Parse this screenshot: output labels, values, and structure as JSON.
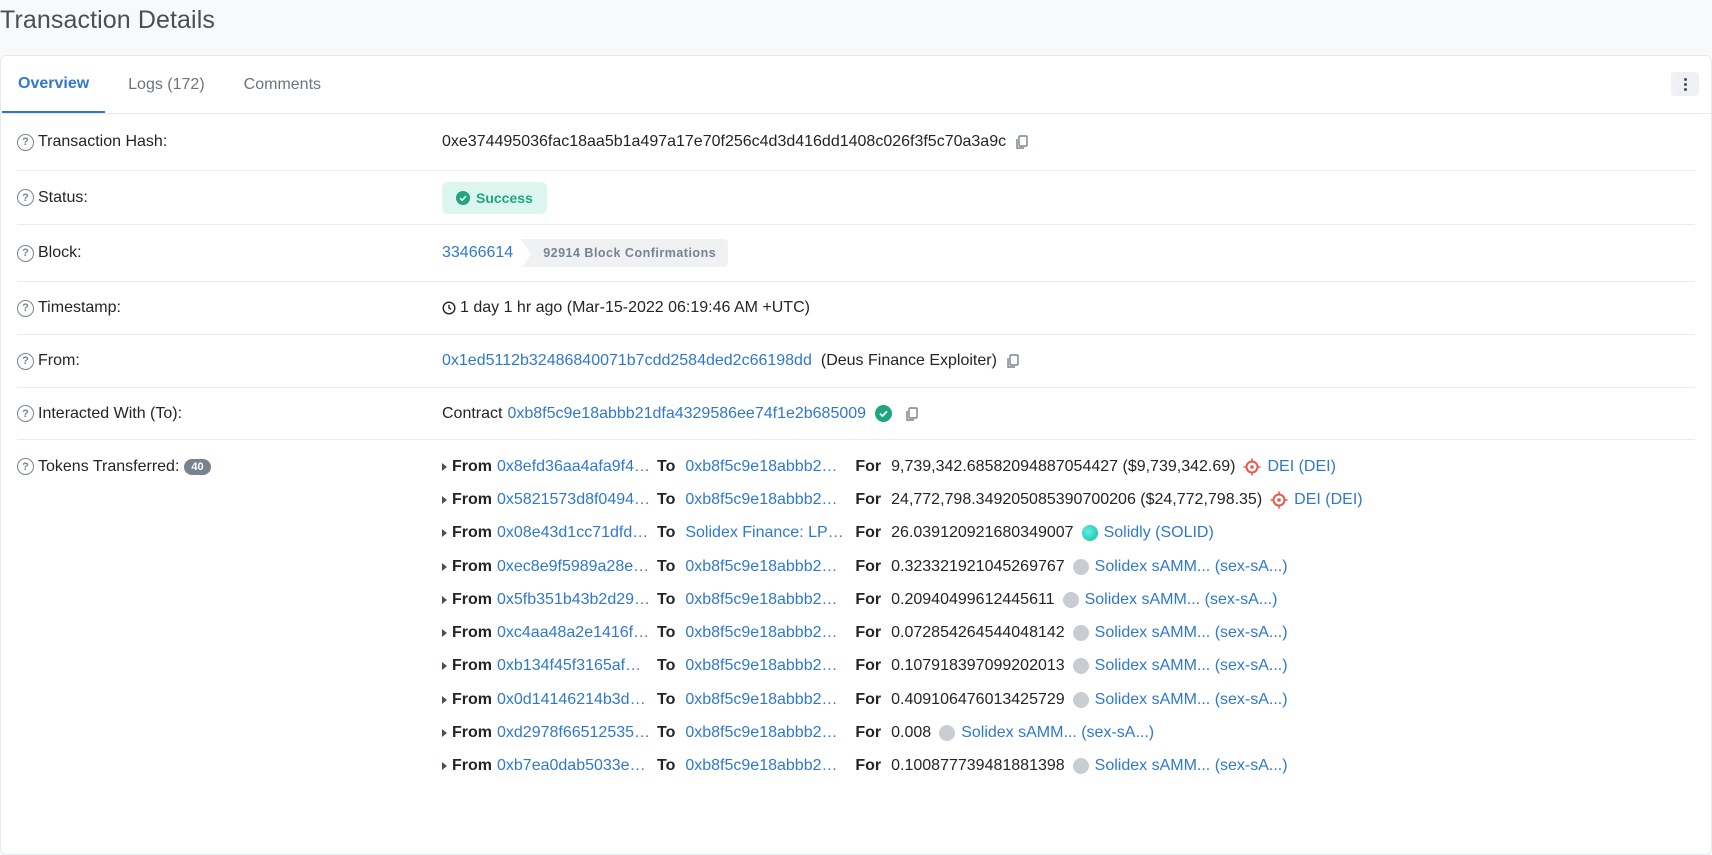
{
  "page": {
    "title": "Transaction Details"
  },
  "tabs": [
    {
      "label": "Overview"
    },
    {
      "label": "Logs (172)"
    },
    {
      "label": "Comments"
    }
  ],
  "overview": {
    "hash_label": "Transaction Hash:",
    "hash": "0xe374495036fac18aa5b1a497a17e70f256c4d3d416dd1408c026f3f5c70a3a9c",
    "status_label": "Status:",
    "status": "Success",
    "block_label": "Block:",
    "block": "33466614",
    "confirmations": "92914 Block Confirmations",
    "timestamp_label": "Timestamp:",
    "timestamp": "1 day 1 hr ago (Mar-15-2022 06:19:46 AM +UTC)",
    "from_label": "From:",
    "from": "0x1ed5112b32486840071b7cdd2584ded2c66198dd",
    "from_name": "(Deus Finance Exploiter)",
    "to_label": "Interacted With (To):",
    "to_prefix": "Contract",
    "to": "0xb8f5c9e18abbb21dfa4329586ee74f1e2b685009",
    "tokens_label": "Tokens Transferred:",
    "tokens_count": "40"
  },
  "transfers": {
    "from_kw": "From",
    "to_kw": "To",
    "for_kw": "For",
    "items": [
      {
        "from": "0x8efd36aa4afa9f4…",
        "to": "0xb8f5c9e18abbb2…",
        "amount": "9,739,342.68582094887054427 ($9,739,342.69)",
        "token": "DEI (DEI)",
        "icon": "dei"
      },
      {
        "from": "0x5821573d8f0494…",
        "to": "0xb8f5c9e18abbb2…",
        "amount": "24,772,798.349205085390700206 ($24,772,798.35)",
        "token": "DEI (DEI)",
        "icon": "dei"
      },
      {
        "from": "0x08e43d1cc71dfd…",
        "to": "Solidex Finance: LP…",
        "amount": "26.039120921680349007",
        "token": "Solidly (SOLID)",
        "icon": "solid"
      },
      {
        "from": "0xec8e9f5989a28e…",
        "to": "0xb8f5c9e18abbb2…",
        "amount": "0.323321921045269767",
        "token": "Solidex sAMM... (sex-sA...)",
        "icon": "grey"
      },
      {
        "from": "0x5fb351b43b2d29…",
        "to": "0xb8f5c9e18abbb2…",
        "amount": "0.20940499612445611",
        "token": "Solidex sAMM... (sex-sA...)",
        "icon": "grey"
      },
      {
        "from": "0xc4aa48a2e1416f…",
        "to": "0xb8f5c9e18abbb2…",
        "amount": "0.072854264544048142",
        "token": "Solidex sAMM... (sex-sA...)",
        "icon": "grey"
      },
      {
        "from": "0xb134f45f3165af…",
        "to": "0xb8f5c9e18abbb2…",
        "amount": "0.107918397099202013",
        "token": "Solidex sAMM... (sex-sA...)",
        "icon": "grey"
      },
      {
        "from": "0x0d14146214b3d…",
        "to": "0xb8f5c9e18abbb2…",
        "amount": "0.409106476013425729",
        "token": "Solidex sAMM... (sex-sA...)",
        "icon": "grey"
      },
      {
        "from": "0xd2978f66512535…",
        "to": "0xb8f5c9e18abbb2…",
        "amount": "0.008",
        "token": "Solidex sAMM... (sex-sA...)",
        "icon": "grey"
      },
      {
        "from": "0xb7ea0dab5033e…",
        "to": "0xb8f5c9e18abbb2…",
        "amount": "0.100877739481881398",
        "token": "Solidex sAMM... (sex-sA...)",
        "icon": "grey"
      }
    ]
  },
  "colors": {
    "link": "#2f78d0",
    "success": "#1fa67e",
    "dei": "#e8594d"
  }
}
